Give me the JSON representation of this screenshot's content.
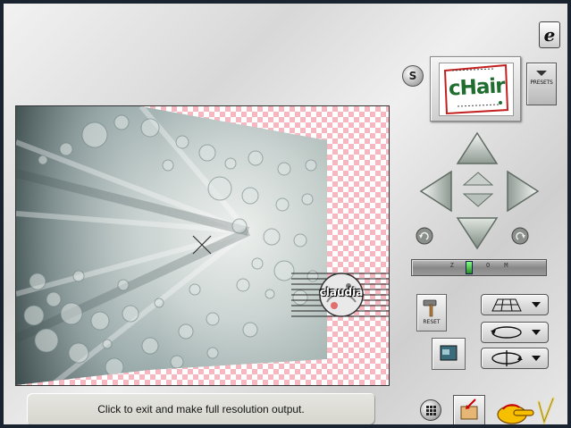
{
  "window": {
    "logo_glyph": "e"
  },
  "toolbar": {
    "s_label": "S",
    "presets_label": "PRESETS",
    "preset_thumbnail_word": "cHair",
    "reset_label": "RESET",
    "zoom_label": "ZOOM",
    "zoom_level": 0.42
  },
  "preview": {
    "watermark_text": "claudia",
    "checker_color": "#f6b8c0"
  },
  "status": {
    "message": "Click to exit and make full resolution output."
  },
  "colors": {
    "accent_green": "#2a8a2a",
    "frame_dark": "#1a2330",
    "brand_yellow": "#f6c000"
  },
  "icons": {
    "arrow_up": "arrow-up-icon",
    "arrow_down": "arrow-down-icon",
    "arrow_left": "arrow-left-icon",
    "arrow_right": "arrow-right-icon",
    "rotate_left": "rotate-left-icon",
    "rotate_right": "rotate-right-icon",
    "perspective": "perspective-grid-icon",
    "rotate": "rotate-cycle-icon",
    "flip": "flip-axis-icon",
    "grid": "grid-icon",
    "apply": "apply-output-icon",
    "hammer": "hammer-icon",
    "hand": "pointing-hand-icon"
  }
}
